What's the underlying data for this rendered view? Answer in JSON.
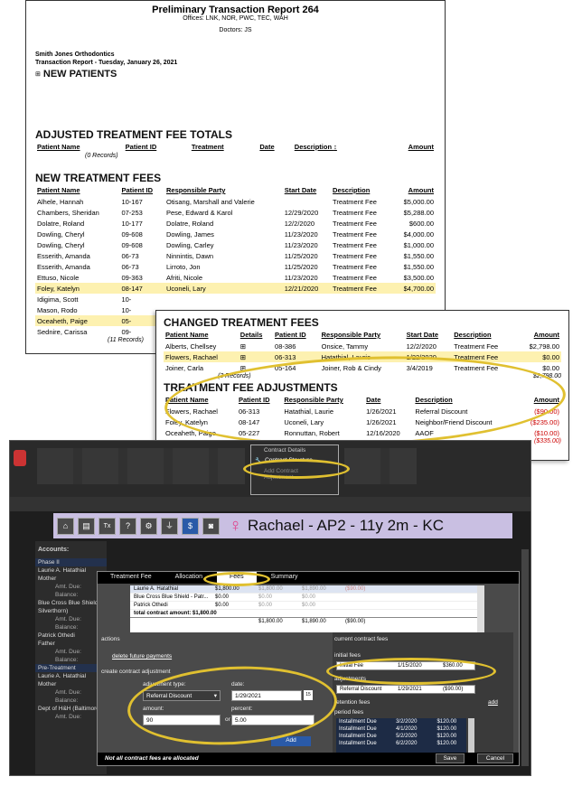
{
  "report": {
    "title": "Preliminary Transaction Report 264",
    "offices": "Offices: LNK, NOR, PWC, TEC, WAH",
    "doctors": "Doctors: JS",
    "practice": "Smith Jones Orthodontics",
    "subtitle": "Transaction Report - Tuesday, January 26, 2021",
    "new_patients": "NEW PATIENTS",
    "adjusted_header": "ADJUSTED TREATMENT FEE TOTALS",
    "adjusted_cols": [
      "Patient Name",
      "Patient ID",
      "Treatment",
      "Date",
      "Description",
      "Amount"
    ],
    "adjusted_sort": "↕",
    "adjusted_records": "(0 Records)",
    "new_fees_header": "NEW TREATMENT FEES",
    "new_fees_cols": [
      "Patient Name",
      "Patient ID",
      "Responsible Party",
      "Start Date",
      "Description",
      "Amount"
    ],
    "new_fees_rows": [
      [
        "Alhele, Hannah",
        "10-167",
        "Otisang, Marshall and Valerie",
        "",
        "Treatment Fee",
        "$5,000.00"
      ],
      [
        "Chambers, Sheridan",
        "07-253",
        "Pese, Edward & Karol",
        "12/29/2020",
        "Treatment Fee",
        "$5,288.00"
      ],
      [
        "Dolatre, Roland",
        "10-177",
        "Dolatre, Roland",
        "12/2/2020",
        "Treatment Fee",
        "$600.00"
      ],
      [
        "Dowling, Cheryl",
        "09-608",
        "Dowling, James",
        "11/23/2020",
        "Treatment Fee",
        "$4,000.00"
      ],
      [
        "Dowling, Cheryl",
        "09-608",
        "Dowling, Carley",
        "11/23/2020",
        "Treatment Fee",
        "$1,000.00"
      ],
      [
        "Esserith, Amanda",
        "06-73",
        "Ninnintis, Dawn",
        "11/25/2020",
        "Treatment Fee",
        "$1,550.00"
      ],
      [
        "Esserith, Amanda",
        "06-73",
        "Lirroto, Jon",
        "11/25/2020",
        "Treatment Fee",
        "$1,550.00"
      ],
      [
        "Ettuso, Nicole",
        "09-363",
        "Afriti, Nicole",
        "11/23/2020",
        "Treatment Fee",
        "$3,500.00"
      ],
      [
        "Foley, Katelyn",
        "08-147",
        "Uconeli, Lary",
        "12/21/2020",
        "Treatment Fee",
        "$4,700.00"
      ],
      [
        "Idigima, Scott",
        "10-",
        "",
        "",
        "",
        ""
      ],
      [
        "Mason, Rodo",
        "10-",
        "",
        "",
        "",
        ""
      ],
      [
        "Oceaheth, Paige",
        "05-",
        "",
        "",
        "",
        ""
      ],
      [
        "Sednire, Carissa",
        "09-",
        "",
        "",
        "",
        ""
      ]
    ],
    "new_fees_records": "(11 Records)"
  },
  "changed": {
    "header": "CHANGED TREATMENT FEES",
    "cols": [
      "Patient Name",
      "Details",
      "Patient ID",
      "Responsible Party",
      "Start Date",
      "Description",
      "Amount"
    ],
    "rows": [
      [
        "Alberts, Chellsey",
        "⊞",
        "08-386",
        "Onsice, Tammy",
        "12/2/2020",
        "Treatment Fee",
        "$2,798.00"
      ],
      [
        "Flowers, Rachael",
        "⊞",
        "06-313",
        "Hatathial, Laurie",
        "1/22/2020",
        "Treatment Fee",
        "$0.00"
      ],
      [
        "Joiner, Carla",
        "⊞",
        "05-164",
        "Joiner, Rob & Cindy",
        "3/4/2019",
        "Treatment Fee",
        "$0.00"
      ]
    ],
    "records": "(3 Records)",
    "total": "$2,798.00",
    "adj_header": "TREATMENT FEE ADJUSTMENTS",
    "adj_cols": [
      "Patient Name",
      "Patient ID",
      "Responsible Party",
      "Date",
      "Description",
      "Amount"
    ],
    "adj_rows": [
      [
        "Flowers, Rachael",
        "06-313",
        "Hatathial, Laurie",
        "1/26/2021",
        "Referral Discount",
        "($90.00)"
      ],
      [
        "Foley, Katelyn",
        "08-147",
        "Uconeli, Lary",
        "1/26/2021",
        "Neighbor/Friend Discount",
        "($235.00)"
      ],
      [
        "Oceaheth, Paige",
        "05-227",
        "Ronnuttan, Robert",
        "12/16/2020",
        "AAOF",
        "($10.00)"
      ]
    ],
    "adj_total": "($335.00)"
  },
  "app": {
    "menu_items": [
      "Contract Details",
      "Contract Structure",
      "Add Contract Adjustment"
    ],
    "patient_banner": "Rachael - AP2 - 11y 2m - KC",
    "nav_icons": [
      "home-icon",
      "document-icon",
      "tx-icon",
      "id-card-icon",
      "gear-icon",
      "network-icon",
      "dollar-icon",
      "camera-icon"
    ],
    "sidebar": {
      "title": "Accounts:",
      "items": [
        "Phase II",
        "Laurie A. Hatathial",
        "Mother",
        "Amt. Due:",
        "Balance:",
        "Blue Cross Blue Shield",
        "Silverthorn)",
        "Amt. Due:",
        "Balance:",
        "Patrick Othedi",
        "Father",
        "Amt. Due:",
        "Balance:",
        "Pre-Treatment",
        "Laurie A. Hatathial",
        "Mother",
        "Amt. Due:",
        "Balance:",
        "Dept of H&H (Baltimore)",
        "Amt. Due:"
      ]
    },
    "modal": {
      "tabs": [
        "Treatment Fee",
        "Allocation",
        "Fees",
        "Summary"
      ],
      "grid_rows": [
        [
          "Laurie A. Hatathial",
          "$1,800.00",
          "$1,800.00",
          "$1,890.00",
          "($90.00)"
        ],
        [
          "Blue Cross Blue Shield - Patr...",
          "$0.00",
          "$0.00",
          "$0.00",
          ""
        ],
        [
          "Patrick Othedi",
          "$0.00",
          "$0.00",
          "$0.00",
          ""
        ]
      ],
      "total_label": "total contract amount: $1,800.00",
      "total_row": [
        "$1,800.00",
        "$1,890.00",
        "($90.00)"
      ],
      "actions_title": "actions",
      "delete_link": "delete future payments",
      "create_title": "create contract adjustment",
      "adj_type_label": "adjustment type:",
      "adj_type_value": "Referral Discount",
      "date_label": "date:",
      "date_value": "1/29/2021",
      "amount_label": "amount:",
      "amount_value": "90",
      "or_label": "or",
      "percent_label": "percent:",
      "percent_value": "5.00",
      "add_button": "Add",
      "current_fees_title": "current contract fees",
      "initial_fees_title": "initial fees",
      "initial_fee": [
        "Initial Fee",
        "1/15/2020",
        "$360.00"
      ],
      "adjustments_title": "adjustments",
      "adjustment": [
        "Referral Discount",
        "1/29/2021",
        "($90.00)"
      ],
      "retention_title": "retention fees",
      "retention_add": "add",
      "period_title": "period fees",
      "period_fees": [
        [
          "Installment Due",
          "3/2/2020",
          "$120.00"
        ],
        [
          "Installment Due",
          "4/1/2020",
          "$120.00"
        ],
        [
          "Installment Due",
          "5/2/2020",
          "$120.00"
        ],
        [
          "Installment Due",
          "6/2/2020",
          "$120.00"
        ]
      ],
      "footer_msg": "Not all contract fees are allocated",
      "save": "Save",
      "cancel": "Cancel"
    }
  }
}
